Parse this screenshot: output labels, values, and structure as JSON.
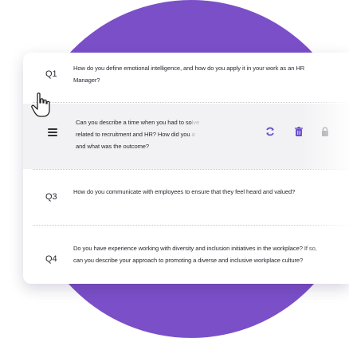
{
  "questions": [
    {
      "label": "Q1",
      "text": "How do you define emotional intelligence, and how do you apply it in your work as an HR Manager?"
    },
    {
      "label": "",
      "text_main_1": "Can you describe a time when you had to so",
      "text_fade_1": "lve",
      "text_main_2": "related to recruitment and HR? How did you ",
      "text_fade_2": "a",
      "text_main_3": "and what was the outcome?"
    },
    {
      "label": "Q3",
      "text": "How do you communicate with employees to ensure that they feel heard and valued?"
    },
    {
      "label": "Q4",
      "text": "Do you have experience working with diversity and inclusion initiatives in the workplace? If so, can you describe your approach to promoting a diverse and inclusive workplace culture?"
    }
  ],
  "icons": {
    "menu": "hamburger-icon",
    "regenerate": "refresh-icon",
    "delete": "trash-icon",
    "lock": "lock-icon",
    "cursor": "hand-pointer-icon"
  },
  "colors": {
    "brand_purple": "#7b4fc8",
    "accent": "#6b4fd0"
  }
}
